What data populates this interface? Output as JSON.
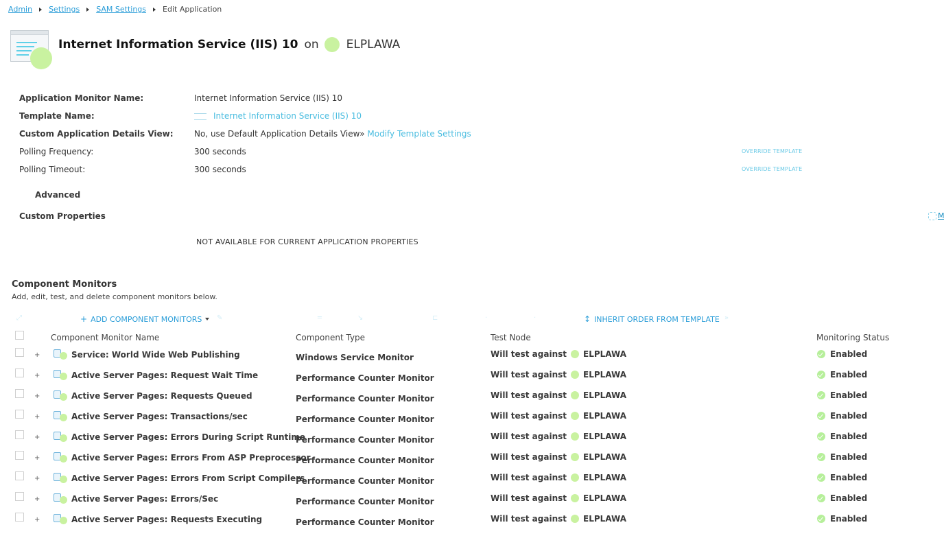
{
  "breadcrumb": {
    "items": [
      "Admin",
      "Settings",
      "SAM Settings"
    ],
    "current": "Edit Application"
  },
  "header": {
    "app_name": "Internet Information Service (IIS) 10",
    "on_label": "on",
    "node_name": "ELPLAWA"
  },
  "properties": {
    "app_monitor_name_label": "Application Monitor Name:",
    "app_monitor_name_value": "Internet Information Service (IIS) 10",
    "template_name_label": "Template Name:",
    "template_name_value": "Internet Information Service (IIS) 10",
    "custom_view_label": "Custom Application Details View:",
    "custom_view_value": "No, use Default Application Details View»",
    "modify_template_link": "Modify Template Settings",
    "polling_frequency_label": "Polling Frequency:",
    "polling_frequency_value": "300 seconds",
    "polling_timeout_label": "Polling Timeout:",
    "polling_timeout_value": "300 seconds",
    "override_label": "OVERRIDE TEMPLATE"
  },
  "advanced_label": "Advanced",
  "custom_properties": {
    "label": "Custom Properties",
    "manage_link": "M",
    "not_available": "NOT AVAILABLE FOR CURRENT APPLICATION PROPERTIES"
  },
  "component_monitors": {
    "title": "Component Monitors",
    "subtitle": "Add, edit, test, and delete component monitors below.",
    "toolbar": {
      "add_label": "ADD COMPONENT MONITORS",
      "inherit_label": "INHERIT ORDER FROM TEMPLATE"
    },
    "columns": [
      "Component Monitor Name",
      "Component Type",
      "Test Node",
      "Monitoring Status"
    ],
    "test_prefix": "Will test against",
    "rows": [
      {
        "name": "Service: World Wide Web Publishing",
        "type": "Windows Service Monitor",
        "node": "ELPLAWA",
        "status": "Enabled"
      },
      {
        "name": "Active Server Pages: Request Wait Time",
        "type": "Performance Counter Monitor",
        "node": "ELPLAWA",
        "status": "Enabled"
      },
      {
        "name": "Active Server Pages: Requests Queued",
        "type": "Performance Counter Monitor",
        "node": "ELPLAWA",
        "status": "Enabled"
      },
      {
        "name": "Active Server Pages: Transactions/sec",
        "type": "Performance Counter Monitor",
        "node": "ELPLAWA",
        "status": "Enabled"
      },
      {
        "name": "Active Server Pages: Errors During Script Runtime",
        "type": "Performance Counter Monitor",
        "node": "ELPLAWA",
        "status": "Enabled"
      },
      {
        "name": "Active Server Pages: Errors From ASP Preprocessor",
        "type": "Performance Counter Monitor",
        "node": "ELPLAWA",
        "status": "Enabled"
      },
      {
        "name": "Active Server Pages: Errors From Script Compilers",
        "type": "Performance Counter Monitor",
        "node": "ELPLAWA",
        "status": "Enabled"
      },
      {
        "name": "Active Server Pages: Errors/Sec",
        "type": "Performance Counter Monitor",
        "node": "ELPLAWA",
        "status": "Enabled"
      },
      {
        "name": "Active Server Pages: Requests Executing",
        "type": "Performance Counter Monitor",
        "node": "ELPLAWA",
        "status": "Enabled"
      }
    ]
  },
  "colors": {
    "link": "#2a9dd8",
    "status_up": "#c9f2a0",
    "enabled_check": "#b6ef9a"
  }
}
